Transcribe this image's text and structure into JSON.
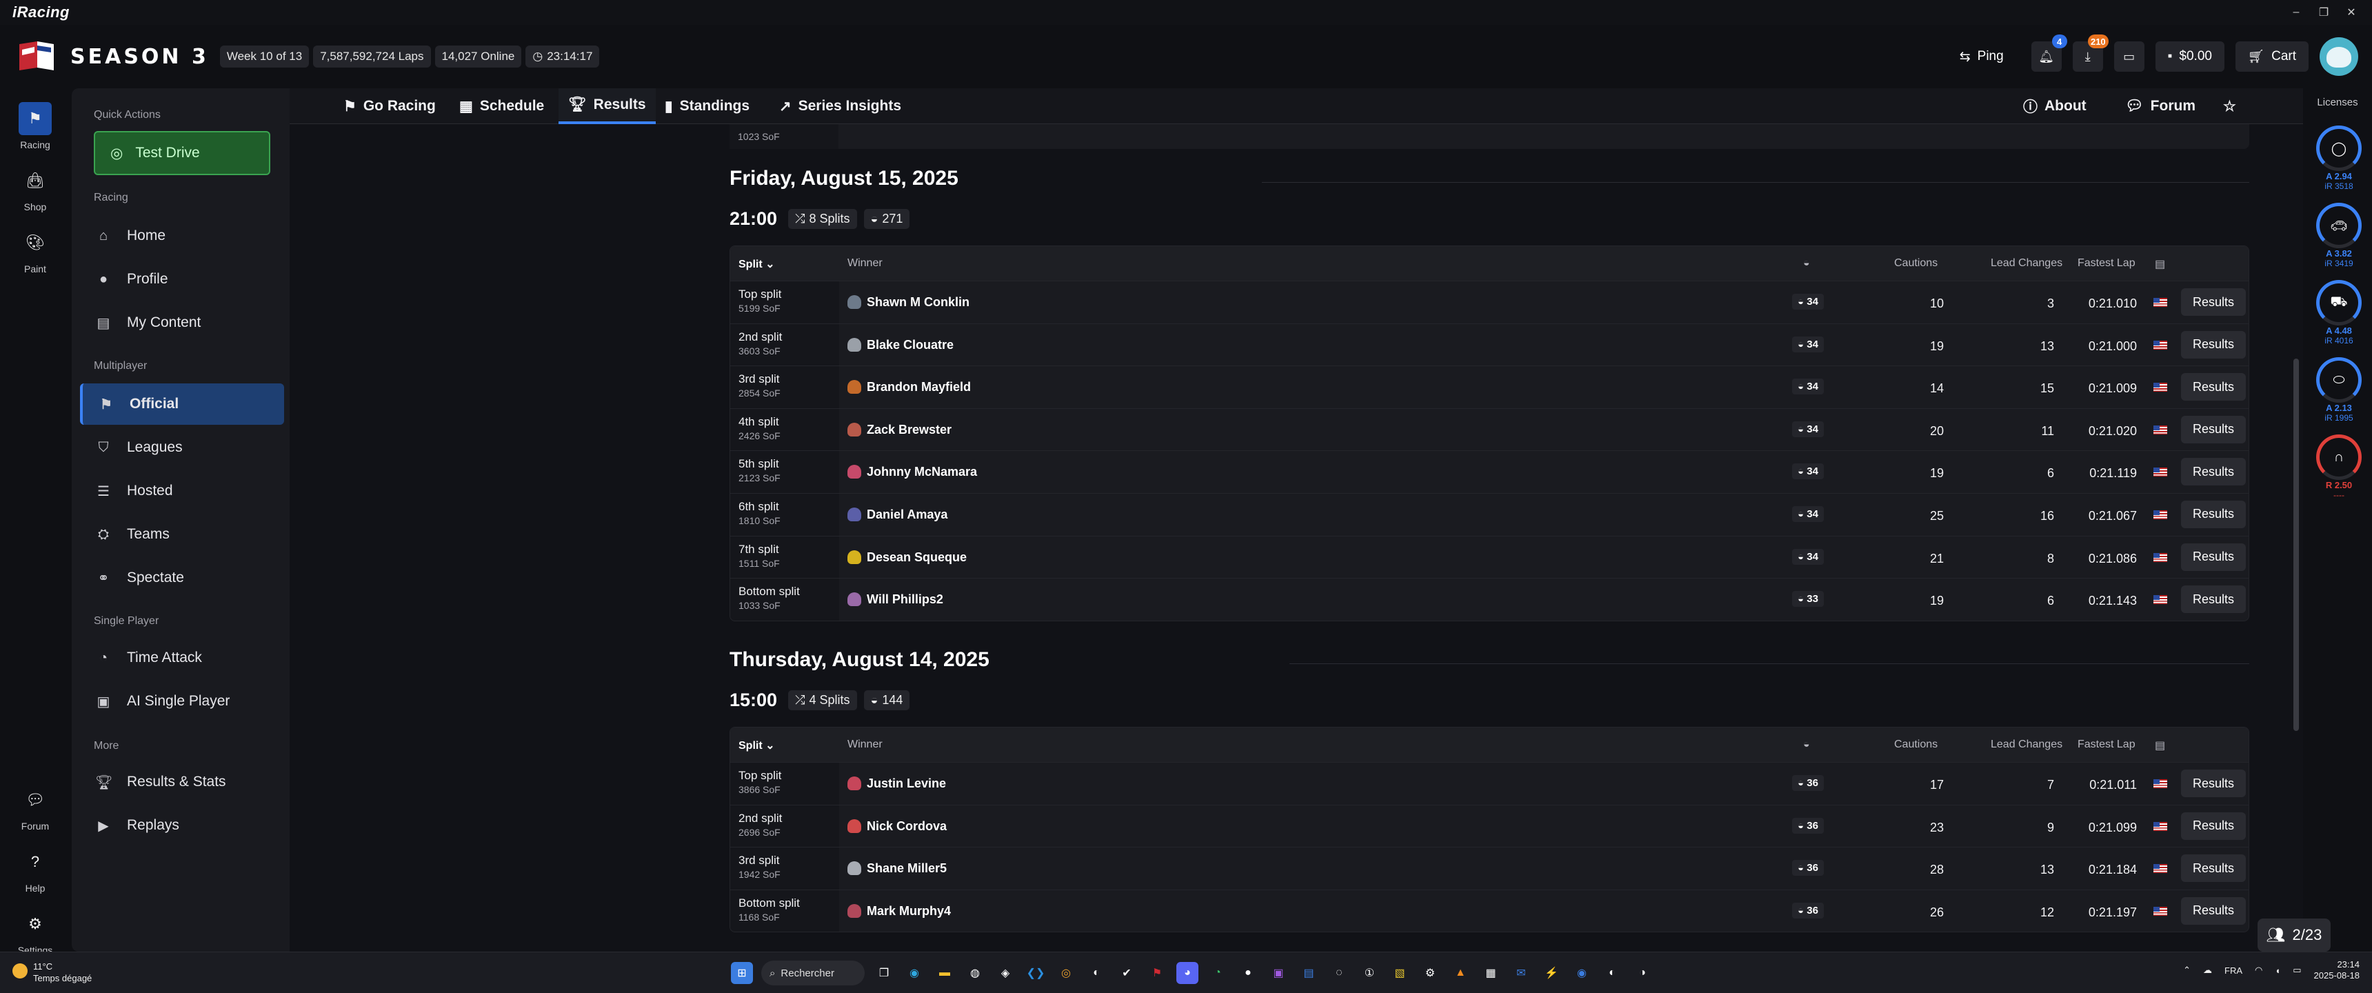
{
  "window": {
    "app_name": "iRacing",
    "controls": [
      "–",
      "❐",
      "✕"
    ]
  },
  "header": {
    "season": "SEASON 3",
    "week": "Week 10 of 13",
    "laps": "7,587,592,724 Laps",
    "online": "14,027 Online",
    "clock": "23:14:17",
    "ping_label": "Ping",
    "notifications_count": "4",
    "downloads_count": "210",
    "wallet": "$0.00",
    "cart_label": "Cart"
  },
  "rail": [
    {
      "label": "Racing",
      "icon": "flag-icon",
      "active": true
    },
    {
      "label": "Shop",
      "icon": "bag-icon"
    },
    {
      "label": "Paint",
      "icon": "palette-icon"
    },
    {
      "label": "Forum",
      "icon": "chat-icon"
    },
    {
      "label": "Help",
      "icon": "help-icon"
    },
    {
      "label": "Settings",
      "icon": "settings-icon"
    }
  ],
  "sidebar": {
    "quick_actions_title": "Quick Actions",
    "test_drive": "Test Drive",
    "racing_title": "Racing",
    "racing_items": [
      "Home",
      "Profile",
      "My Content"
    ],
    "multiplayer_title": "Multiplayer",
    "multiplayer_items": [
      "Official",
      "Leagues",
      "Hosted",
      "Teams",
      "Spectate"
    ],
    "single_title": "Single Player",
    "single_items": [
      "Time Attack",
      "AI Single Player"
    ],
    "more_title": "More",
    "more_items": [
      "Results & Stats",
      "Replays"
    ]
  },
  "tabs": [
    "Go Racing",
    "Schedule",
    "Results",
    "Standings",
    "Series Insights"
  ],
  "tabs_right": [
    "About",
    "Forum"
  ],
  "content": {
    "prev_sof": "1023 SoF",
    "columns": {
      "split": "Split",
      "winner": "Winner",
      "cautions": "Cautions",
      "lead_changes": "Lead Changes",
      "fastest_lap": "Fastest Lap"
    },
    "result_button": "Results",
    "days": [
      {
        "date": "Friday, August 15, 2025",
        "time": "21:00",
        "splits": "8 Splits",
        "entries": "271",
        "rows": [
          {
            "split": "Top split",
            "sof": "5199 SoF",
            "winner": "Shawn M Conklin",
            "laps": "34",
            "cautions": "10",
            "lead": "3",
            "fastest": "0:21.010",
            "helmet": "#6d7a8a"
          },
          {
            "split": "2nd split",
            "sof": "3603 SoF",
            "winner": "Blake Clouatre",
            "laps": "34",
            "cautions": "19",
            "lead": "13",
            "fastest": "0:21.000",
            "helmet": "#9aa0a8"
          },
          {
            "split": "3rd split",
            "sof": "2854 SoF",
            "winner": "Brandon Mayfield",
            "laps": "34",
            "cautions": "14",
            "lead": "15",
            "fastest": "0:21.009",
            "helmet": "#c46a2a"
          },
          {
            "split": "4th split",
            "sof": "2426 SoF",
            "winner": "Zack Brewster",
            "laps": "34",
            "cautions": "20",
            "lead": "11",
            "fastest": "0:21.020",
            "helmet": "#b85a4a"
          },
          {
            "split": "5th split",
            "sof": "2123 SoF",
            "winner": "Johnny McNamara",
            "laps": "34",
            "cautions": "19",
            "lead": "6",
            "fastest": "0:21.119",
            "helmet": "#c64a6a"
          },
          {
            "split": "6th split",
            "sof": "1810 SoF",
            "winner": "Daniel Amaya",
            "laps": "34",
            "cautions": "25",
            "lead": "16",
            "fastest": "0:21.067",
            "helmet": "#5b5fa8"
          },
          {
            "split": "7th split",
            "sof": "1511 SoF",
            "winner": "Desean Squeque",
            "laps": "34",
            "cautions": "21",
            "lead": "8",
            "fastest": "0:21.086",
            "helmet": "#d6b21e"
          },
          {
            "split": "Bottom split",
            "sof": "1033 SoF",
            "winner": "Will Phillips2",
            "laps": "33",
            "cautions": "19",
            "lead": "6",
            "fastest": "0:21.143",
            "helmet": "#9a6aa8"
          }
        ]
      },
      {
        "date": "Thursday, August 14, 2025",
        "time": "15:00",
        "splits": "4 Splits",
        "entries": "144",
        "rows": [
          {
            "split": "Top split",
            "sof": "3866 SoF",
            "winner": "Justin Levine",
            "laps": "36",
            "cautions": "17",
            "lead": "7",
            "fastest": "0:21.011",
            "helmet": "#c6465a"
          },
          {
            "split": "2nd split",
            "sof": "2696 SoF",
            "winner": "Nick Cordova",
            "laps": "36",
            "cautions": "23",
            "lead": "9",
            "fastest": "0:21.099",
            "helmet": "#d04a4a"
          },
          {
            "split": "3rd split",
            "sof": "1942 SoF",
            "winner": "Shane Miller5",
            "laps": "36",
            "cautions": "28",
            "lead": "13",
            "fastest": "0:21.184",
            "helmet": "#a8acb4"
          },
          {
            "split": "Bottom split",
            "sof": "1168 SoF",
            "winner": "Mark Murphy4",
            "laps": "36",
            "cautions": "26",
            "lead": "12",
            "fastest": "0:21.197",
            "helmet": "#b0485a"
          }
        ]
      }
    ]
  },
  "licenses": {
    "title": "Licenses",
    "items": [
      {
        "class": "A 2.94",
        "ir": "iR 3518",
        "color": "#3b82f6",
        "icon": "oval-icon"
      },
      {
        "class": "A 3.82",
        "ir": "iR 3419",
        "color": "#3b82f6",
        "icon": "sports-car-icon"
      },
      {
        "class": "A 4.48",
        "ir": "iR 4016",
        "color": "#3b82f6",
        "icon": "formula-car-icon"
      },
      {
        "class": "A 2.13",
        "ir": "iR 1995",
        "color": "#3b82f6",
        "icon": "dirt-oval-icon"
      },
      {
        "class": "R 2.50",
        "ir": "----",
        "color": "#e0403a",
        "icon": "dirt-road-icon"
      }
    ]
  },
  "counter": "2/23",
  "taskbar": {
    "temp": "11°C",
    "weather": "Temps dégagé",
    "search": "Rechercher",
    "lang": "FRA",
    "time": "23:14",
    "date": "2025-08-18"
  }
}
